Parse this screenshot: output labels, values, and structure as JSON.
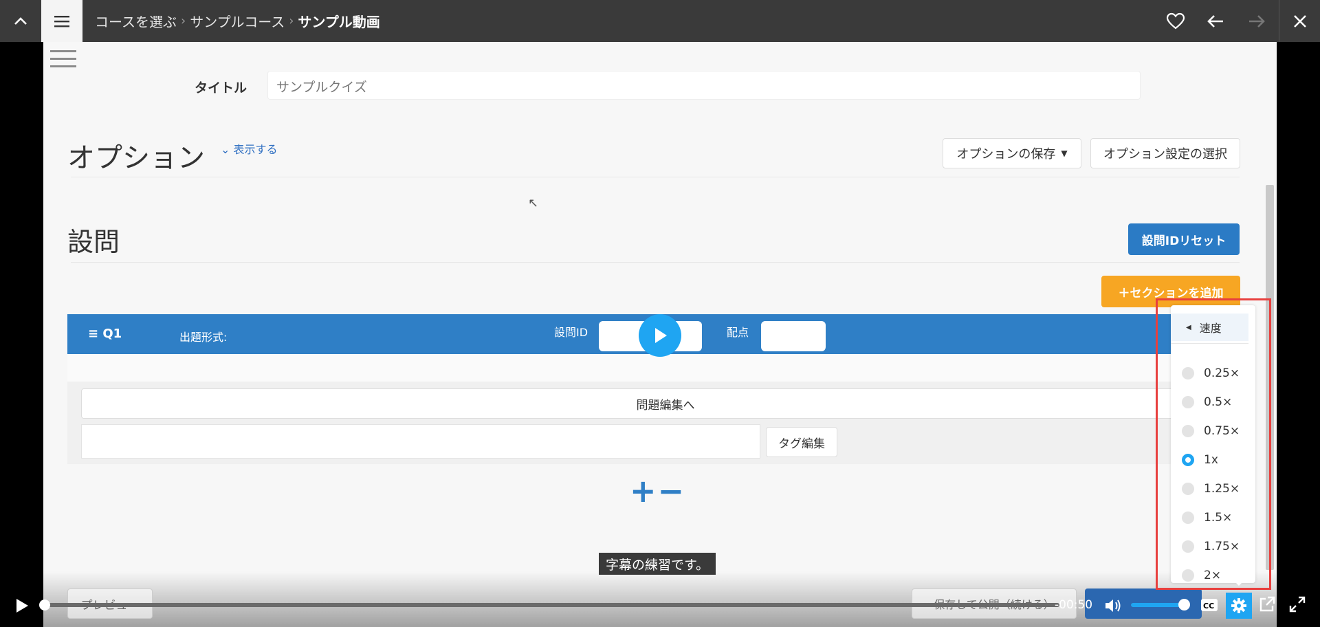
{
  "topbar": {
    "breadcrumbs": [
      "コースを選ぶ",
      "サンプルコース",
      "サンプル動画"
    ],
    "separator": "›"
  },
  "page": {
    "title_label": "タイトル",
    "title_value": "サンプルクイズ",
    "options_heading": "オプション",
    "show_link": "表示する",
    "save_options_label": "オプションの保存",
    "select_options_label": "オプション設定の選択",
    "questions_heading": "設問",
    "reset_id_label": "設問IDリセット",
    "add_section_label": "＋セクションを追加",
    "question": {
      "number": "Q1",
      "type_label": "出題形式:",
      "id_label": "設問ID",
      "points_label": "配点",
      "edit_label": "問題編集へ",
      "tag_edit_label": "タグ編集"
    },
    "plus_minus": "+−",
    "preview_label": "プレビュー",
    "publish_label": "保存して公開（続ける）"
  },
  "player": {
    "caption": "字幕の練習です。",
    "time": "-00:50",
    "progress_fraction": 0.0,
    "volume_fraction": 1.0,
    "accent_color": "#1fa5f2"
  },
  "speed_menu": {
    "title": "速度",
    "options": [
      "0.25×",
      "0.5×",
      "0.75×",
      "1x",
      "1.25×",
      "1.5×",
      "1.75×",
      "2×"
    ],
    "selected": "1x"
  }
}
